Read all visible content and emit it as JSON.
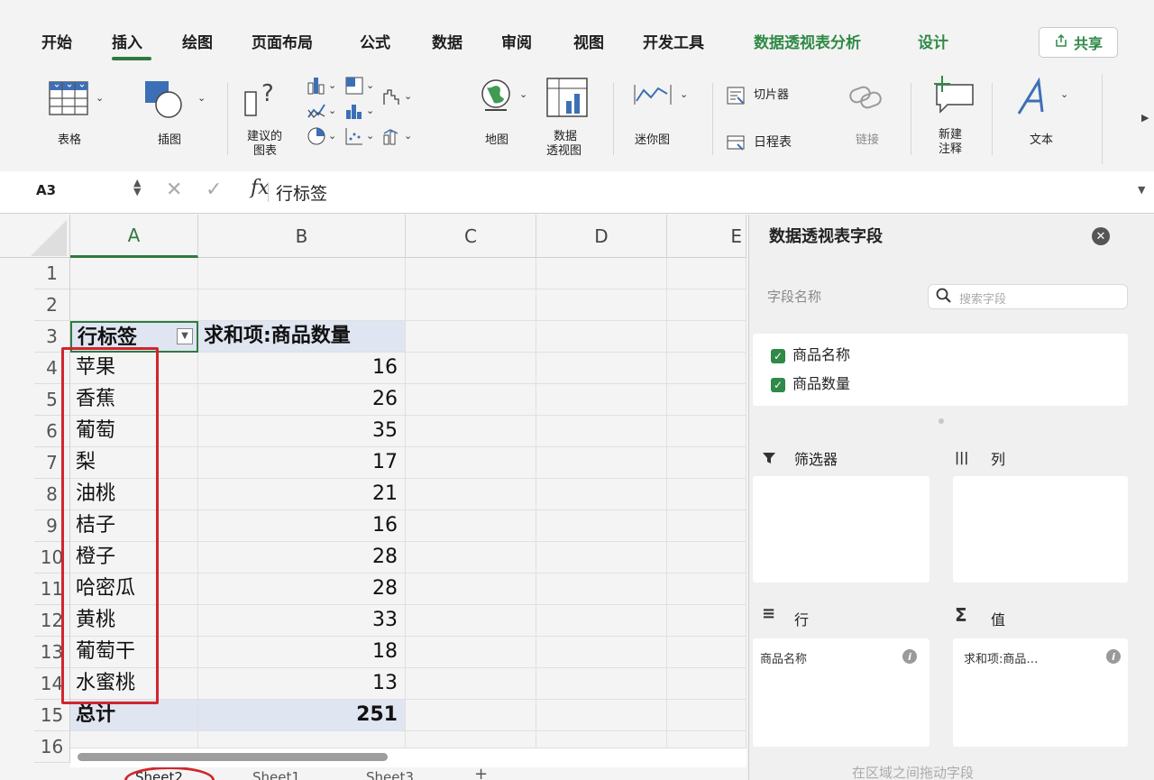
{
  "ribbon_tabs": [
    "开始",
    "插入",
    "绘图",
    "页面布局",
    "公式",
    "数据",
    "审阅",
    "视图",
    "开发工具",
    "数据透视表分析",
    "设计"
  ],
  "share_label": "共享",
  "ribbon": {
    "table": "表格",
    "illustrations": "插图",
    "recommended_charts_1": "建议的",
    "recommended_charts_2": "图表",
    "maps": "地图",
    "pivot_chart_1": "数据",
    "pivot_chart_2": "透视图",
    "sparklines": "迷你图",
    "slicer": "切片器",
    "timeline": "日程表",
    "link": "链接",
    "new_comment_1": "新建",
    "new_comment_2": "注释",
    "text": "文本"
  },
  "formula_bar": {
    "name_box": "A3",
    "formula": "行标签"
  },
  "columns": [
    "A",
    "B",
    "C",
    "D",
    "E"
  ],
  "rows": [
    "1",
    "2",
    "3",
    "4",
    "5",
    "6",
    "7",
    "8",
    "9",
    "10",
    "11",
    "12",
    "13",
    "14",
    "15",
    "16"
  ],
  "pivot": {
    "row_header": "行标签",
    "value_header": "求和项:商品数量",
    "items": [
      {
        "name": "苹果",
        "qty": "16"
      },
      {
        "name": "香蕉",
        "qty": "26"
      },
      {
        "name": "葡萄",
        "qty": "35"
      },
      {
        "name": "梨",
        "qty": "17"
      },
      {
        "name": "油桃",
        "qty": "21"
      },
      {
        "name": "桔子",
        "qty": "16"
      },
      {
        "name": "橙子",
        "qty": "28"
      },
      {
        "name": "哈密瓜",
        "qty": "28"
      },
      {
        "name": "黄桃",
        "qty": "33"
      },
      {
        "name": "葡萄干",
        "qty": "18"
      },
      {
        "name": "水蜜桃",
        "qty": "13"
      }
    ],
    "total_label": "总计",
    "total_value": "251"
  },
  "pane": {
    "title": "数据透视表字段",
    "field_name_label": "字段名称",
    "search_placeholder": "搜索字段",
    "fields": [
      "商品名称",
      "商品数量"
    ],
    "filters_label": "筛选器",
    "columns_label": "列",
    "rows_label": "行",
    "values_label": "值",
    "rows_chip": "商品名称",
    "values_chip": "求和项:商品…",
    "drag_hint": "在区域之间拖动字段"
  },
  "sheets": [
    "Sheet2",
    "Sheet1",
    "Sheet3"
  ],
  "colors": {
    "accent_green": "#2f8a47",
    "highlight_red": "#d0262d",
    "pivot_blue": "#dfe5f1"
  }
}
